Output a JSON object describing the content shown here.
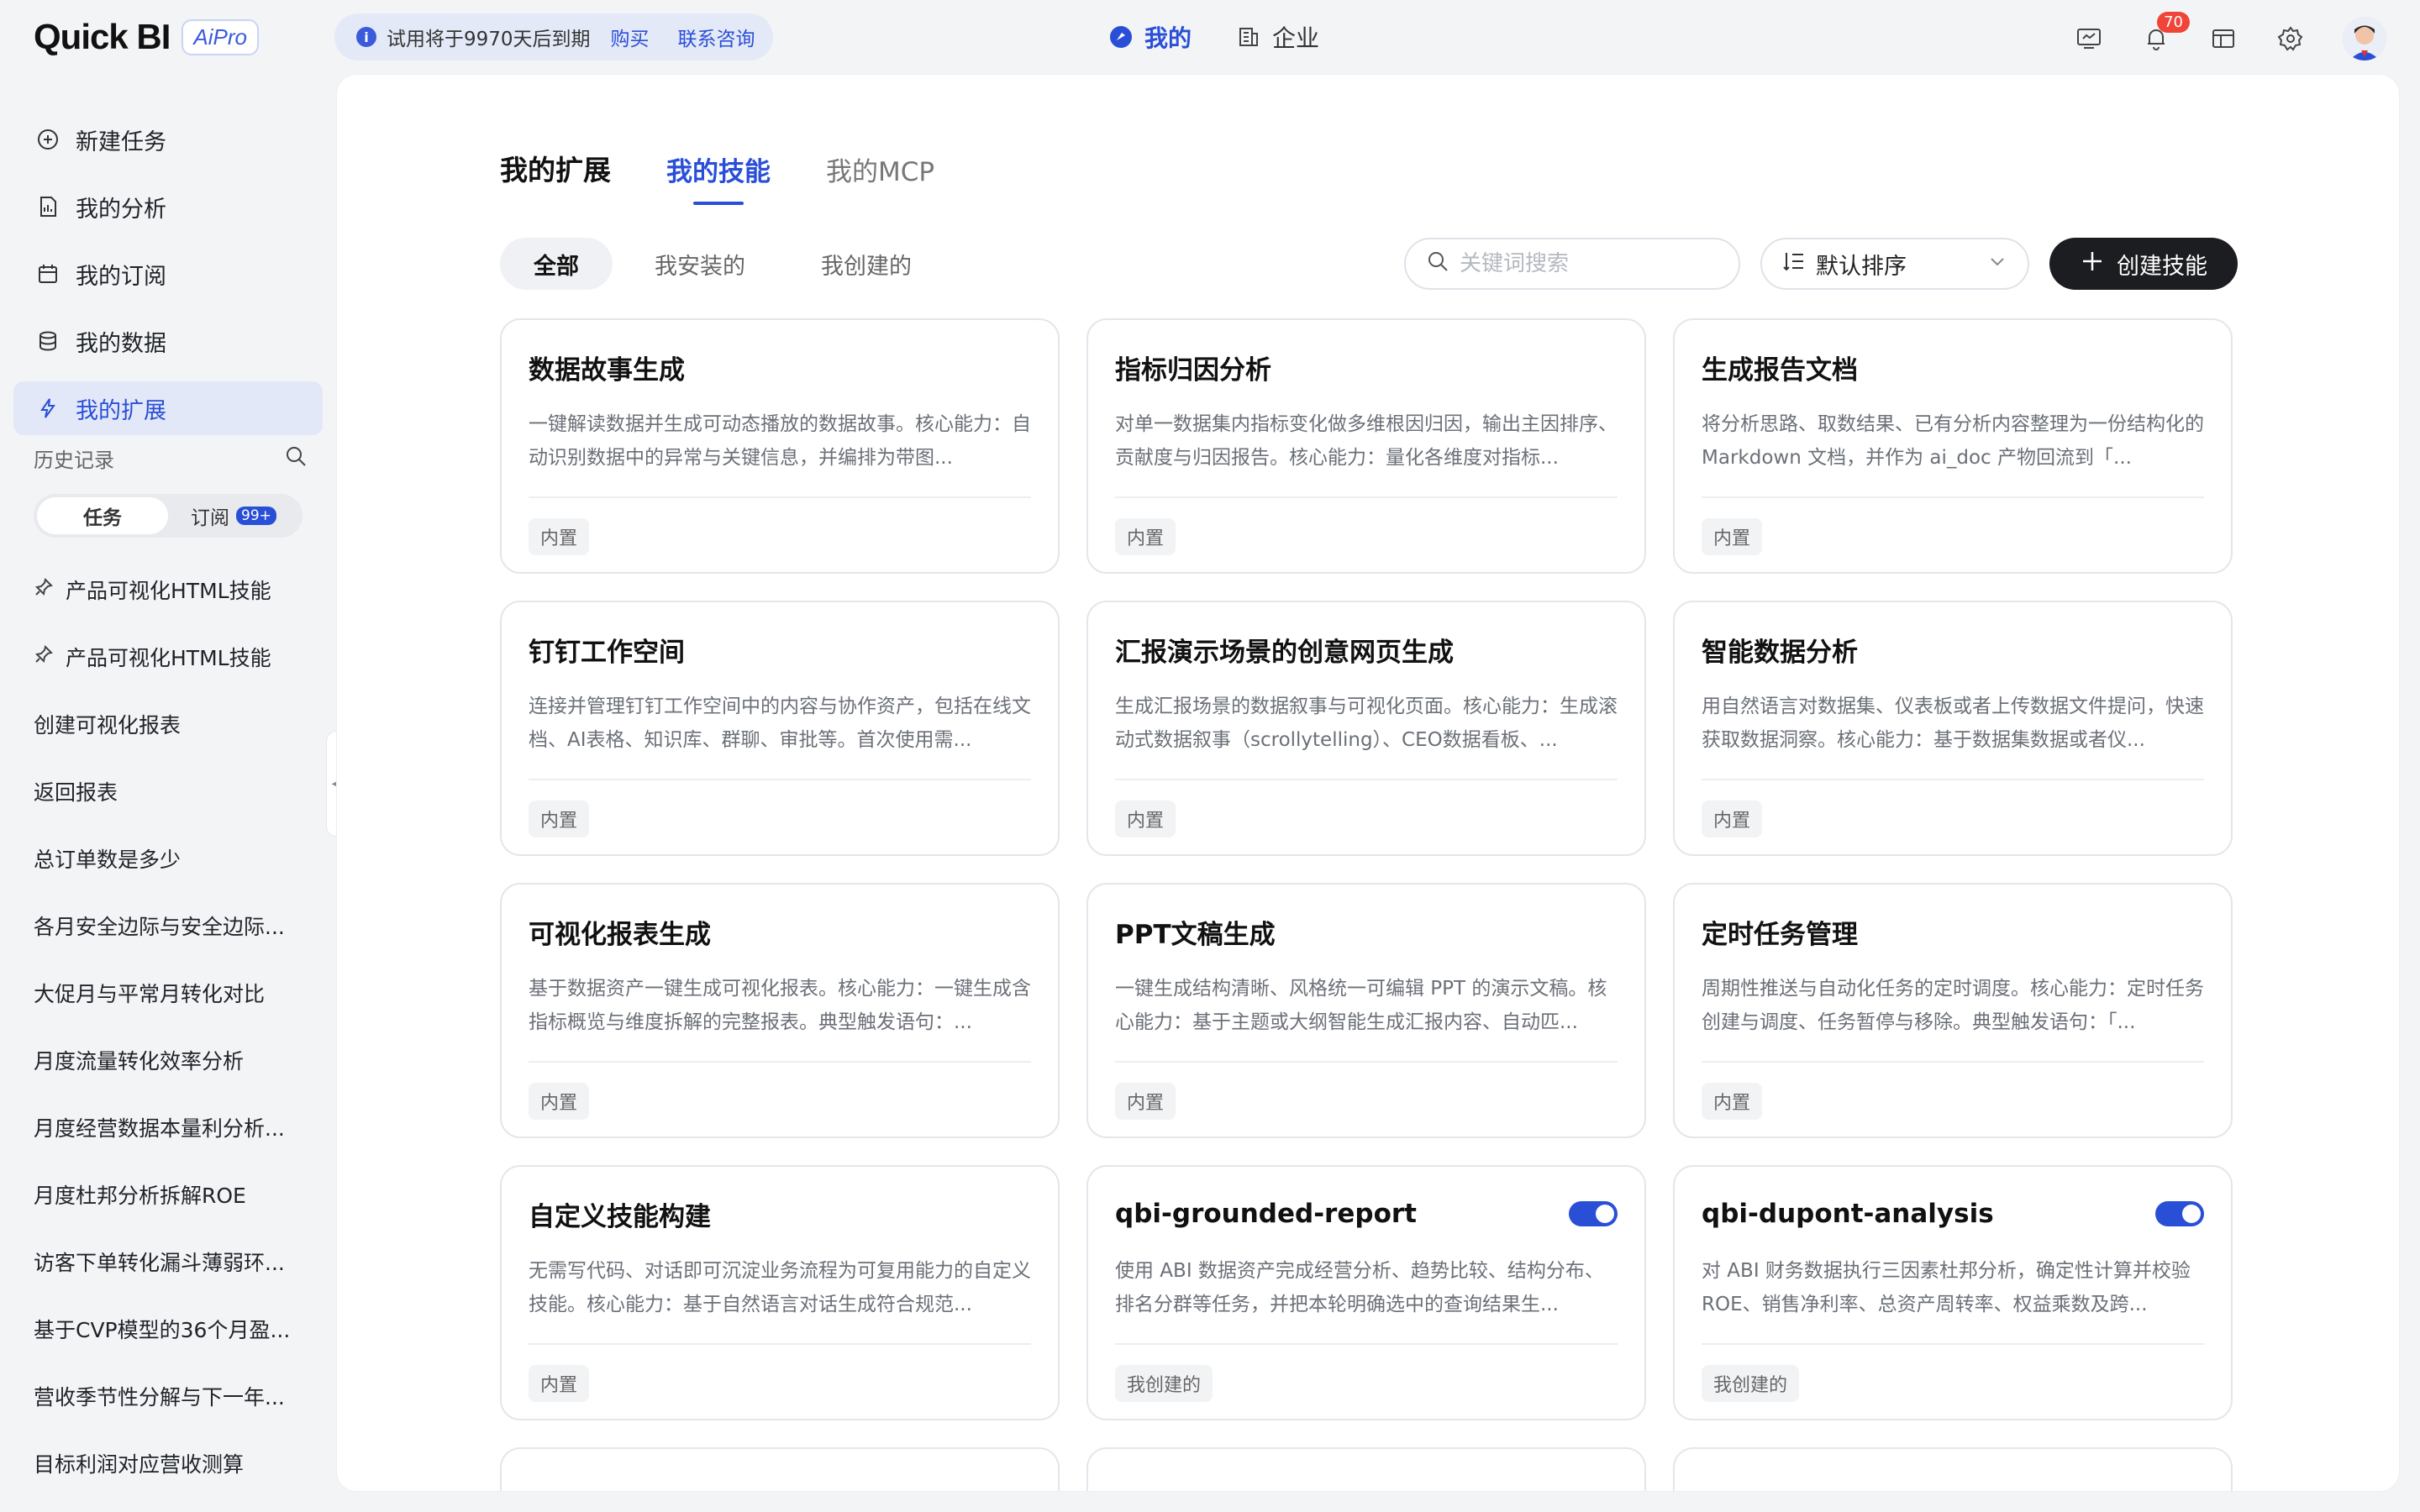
{
  "app": {
    "logo": "Quick BI",
    "badge": "AiPro"
  },
  "trial": {
    "text": "试用将于9970天后到期",
    "buy": "购买",
    "contact": "联系咨询"
  },
  "center_nav": [
    {
      "label": "我的",
      "active": true
    },
    {
      "label": "企业",
      "active": false
    }
  ],
  "notifications": {
    "count": "70"
  },
  "sidebar": {
    "items": [
      {
        "label": "新建任务",
        "icon": "plus-circle-icon"
      },
      {
        "label": "我的分析",
        "icon": "chart-doc-icon"
      },
      {
        "label": "我的订阅",
        "icon": "calendar-icon"
      },
      {
        "label": "我的数据",
        "icon": "database-icon"
      },
      {
        "label": "我的扩展",
        "icon": "bolt-icon",
        "active": true
      }
    ],
    "history_title": "历史记录",
    "segments": {
      "task": "任务",
      "subscribe": "订阅",
      "subscribe_badge": "99+"
    },
    "history": [
      "产品可视化HTML技能",
      "产品可视化HTML技能",
      "创建可视化报表",
      "返回报表",
      "总订单数是多少",
      "各月安全边际与安全边际...",
      "大促月与平常月转化对比",
      "月度流量转化效率分析",
      "月度经营数据本量利分析...",
      "月度杜邦分析拆解ROE",
      "访客下单转化漏斗薄弱环...",
      "基于CVP模型的36个月盈...",
      "营收季节性分解与下一年...",
      "目标利润对应营收测算"
    ]
  },
  "main": {
    "title": "我的扩展",
    "tabs": [
      {
        "label": "我的技能",
        "active": true
      },
      {
        "label": "我的MCP",
        "active": false
      }
    ],
    "filters": [
      {
        "label": "全部",
        "active": true
      },
      {
        "label": "我安装的"
      },
      {
        "label": "我创建的"
      }
    ],
    "search_placeholder": "关键词搜索",
    "sort_label": "默认排序",
    "create_label": "创建技能",
    "cards": [
      {
        "title": "数据故事生成",
        "desc": "一键解读数据并生成可动态播放的数据故事。核心能力：自动识别数据中的异常与关键信息，并编排为带图...",
        "tag": "内置"
      },
      {
        "title": "指标归因分析",
        "desc": "对单一数据集内指标变化做多维根因归因，输出主因排序、贡献度与归因报告。核心能力：量化各维度对指标...",
        "tag": "内置"
      },
      {
        "title": "生成报告文档",
        "desc": "将分析思路、取数结果、已有分析内容整理为一份结构化的 Markdown 文档，并作为 ai_doc 产物回流到「...",
        "tag": "内置"
      },
      {
        "title": "钉钉工作空间",
        "desc": "连接并管理钉钉工作空间中的内容与协作资产，包括在线文档、AI表格、知识库、群聊、审批等。首次使用需...",
        "tag": "内置"
      },
      {
        "title": "汇报演示场景的创意网页生成",
        "desc": "生成汇报场景的数据叙事与可视化页面。核心能力：生成滚动式数据叙事（scrollytelling）、CEO数据看板、...",
        "tag": "内置"
      },
      {
        "title": "智能数据分析",
        "desc": "用自然语言对数据集、仪表板或者上传数据文件提问，快速获取数据洞察。核心能力：基于数据集数据或者仪...",
        "tag": "内置"
      },
      {
        "title": "可视化报表生成",
        "desc": "基于数据资产一键生成可视化报表。核心能力：一键生成含指标概览与维度拆解的完整报表。典型触发语句：...",
        "tag": "内置"
      },
      {
        "title": "PPT文稿生成",
        "desc": "一键生成结构清晰、风格统一可编辑 PPT 的演示文稿。核心能力：基于主题或大纲智能生成汇报内容、自动匹...",
        "tag": "内置"
      },
      {
        "title": "定时任务管理",
        "desc": "周期性推送与自动化任务的定时调度。核心能力：定时任务创建与调度、任务暂停与移除。典型触发语句：「...",
        "tag": "内置"
      },
      {
        "title": "自定义技能构建",
        "desc": "无需写代码、对话即可沉淀业务流程为可复用能力的自定义技能。核心能力：基于自然语言对话生成符合规范...",
        "tag": "内置"
      },
      {
        "title": "qbi-grounded-report",
        "desc": "使用 ABI 数据资产完成经营分析、趋势比较、结构分布、排名分群等任务，并把本轮明确选中的查询结果生...",
        "tag": "我创建的",
        "toggle": true
      },
      {
        "title": "qbi-dupont-analysis",
        "desc": "对 ABI 财务数据执行三因素杜邦分析，确定性计算并校验 ROE、销售净利率、总资产周转率、权益乘数及跨...",
        "tag": "我创建的",
        "toggle": true
      }
    ]
  }
}
